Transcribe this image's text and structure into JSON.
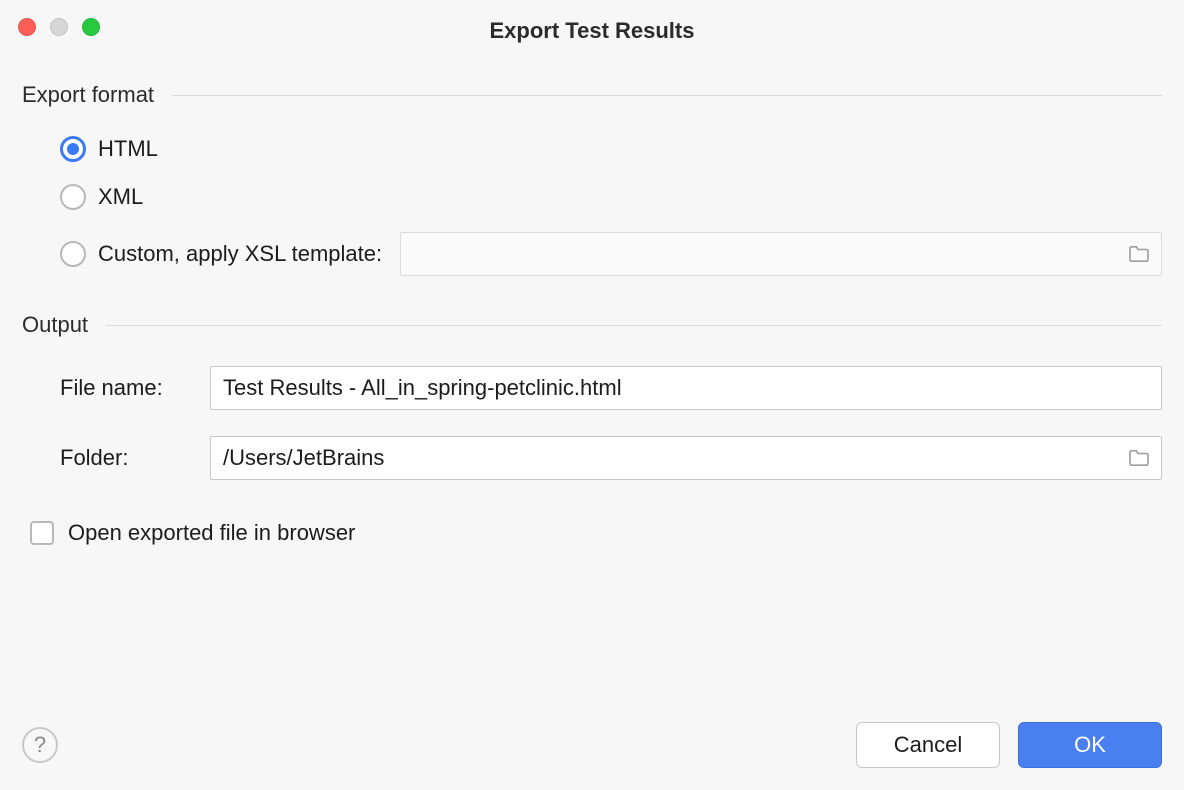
{
  "window": {
    "title": "Export Test Results"
  },
  "sections": {
    "export_format": {
      "label": "Export format",
      "options": {
        "html": "HTML",
        "xml": "XML",
        "custom": "Custom, apply XSL template:"
      },
      "selected": "html",
      "xsl_template_value": ""
    },
    "output": {
      "label": "Output",
      "file_name_label": "File name:",
      "file_name_value": "Test Results - All_in_spring-petclinic.html",
      "folder_label": "Folder:",
      "folder_value": "/Users/JetBrains"
    }
  },
  "options": {
    "open_in_browser_label": "Open exported file in browser",
    "open_in_browser_checked": false
  },
  "buttons": {
    "help": "?",
    "cancel": "Cancel",
    "ok": "OK"
  }
}
